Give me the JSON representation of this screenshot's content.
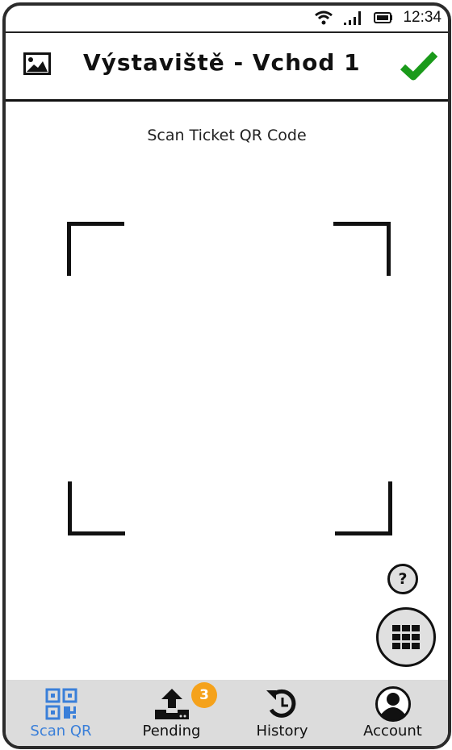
{
  "status_bar": {
    "time": "12:34",
    "icons": [
      "wifi-icon",
      "signal-icon",
      "battery-icon"
    ]
  },
  "header": {
    "image_icon": "image-icon",
    "title": "Výstaviště - Vchod 1",
    "confirm_icon": "checkmark-icon",
    "confirm_color": "#1a9a1a"
  },
  "scanner": {
    "label": "Scan Ticket QR Code"
  },
  "floating": {
    "help_label": "?",
    "keypad_icon": "keypad-grid-icon"
  },
  "nav": {
    "active_color": "#3a7fd9",
    "items": [
      {
        "label": "Scan QR",
        "icon": "qr-code-icon",
        "active": true
      },
      {
        "label": "Pending",
        "icon": "upload-icon",
        "badge": "3",
        "badge_color": "#f5a21b"
      },
      {
        "label": "History",
        "icon": "history-icon"
      },
      {
        "label": "Account",
        "icon": "account-icon"
      }
    ]
  }
}
